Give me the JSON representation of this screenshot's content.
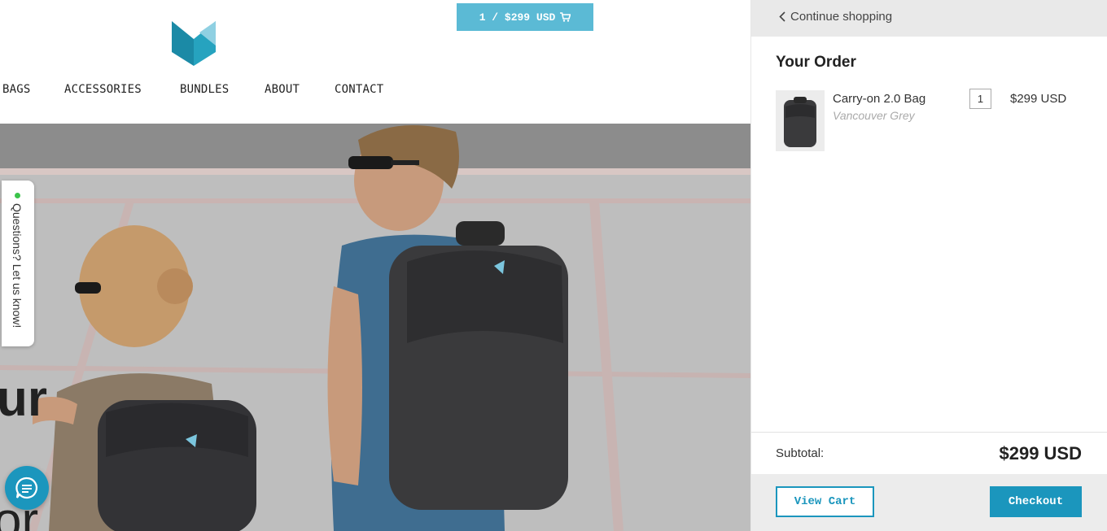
{
  "header": {
    "cart_summary": "1 / $299 USD",
    "cart_icon": "shopping-cart-icon",
    "brand_color": "#1b96bd",
    "cart_button_color": "#5bbad5"
  },
  "nav": {
    "items": [
      "BAGS",
      "ACCESSORIES",
      "BUNDLES",
      "ABOUT",
      "CONTACT"
    ]
  },
  "hero": {
    "word_line1": "ur",
    "word_line2": "or"
  },
  "widgets": {
    "questions_tab": "Questions? Let us know!",
    "status_color": "#3cc44b",
    "chat_icon": "chat-bubble-icon"
  },
  "cart_panel": {
    "continue_label": "Continue shopping",
    "order_title": "Your Order",
    "items": [
      {
        "name": "Carry-on 2.0 Bag",
        "variant": "Vancouver Grey",
        "quantity": "1",
        "price": "$299 USD"
      }
    ],
    "subtotal_label": "Subtotal:",
    "subtotal_value": "$299 USD",
    "view_cart_label": "View Cart",
    "checkout_label": "Checkout"
  }
}
